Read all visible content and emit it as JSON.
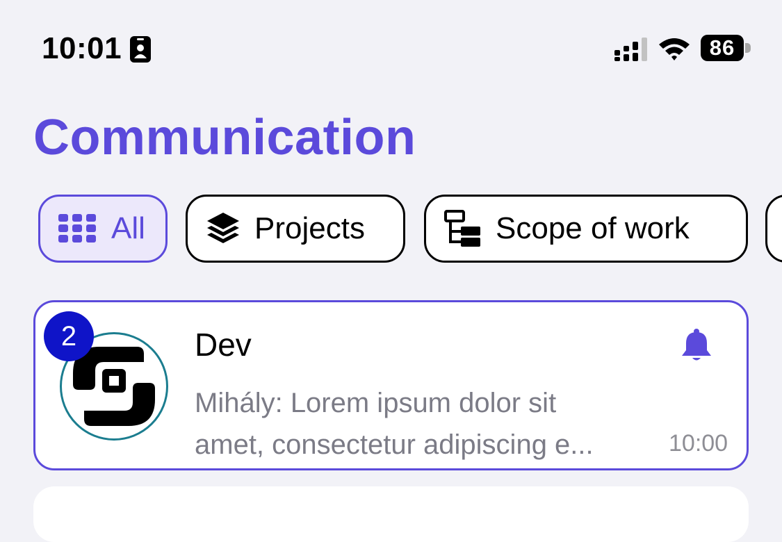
{
  "status_bar": {
    "time": "10:01",
    "battery_level": "86",
    "icons": [
      "contact-card-icon",
      "cellular-signal-icon",
      "wifi-icon",
      "battery-icon"
    ]
  },
  "page": {
    "title": "Communication"
  },
  "filters": [
    {
      "label": "All",
      "icon": "grid-icon",
      "active": true
    },
    {
      "label": "Projects",
      "icon": "layers-icon",
      "active": false
    },
    {
      "label": "Scope of work",
      "icon": "hierarchy-icon",
      "active": false
    }
  ],
  "chats": [
    {
      "name": "Dev",
      "unread_count": "2",
      "preview_line1": "Mihály: Lorem ipsum dolor sit",
      "preview_line2": "amet, consectetur adipiscing e...",
      "time": "10:00",
      "avatar": "dev-logo",
      "notification_icon": "bell-icon"
    }
  ],
  "colors": {
    "accent": "#5b4adb",
    "active_chip_bg": "#ece8fb",
    "badge": "#0f14c8",
    "avatar_ring": "#1b7d8f",
    "background": "#f2f2f7",
    "muted_text": "#7b7b86"
  }
}
